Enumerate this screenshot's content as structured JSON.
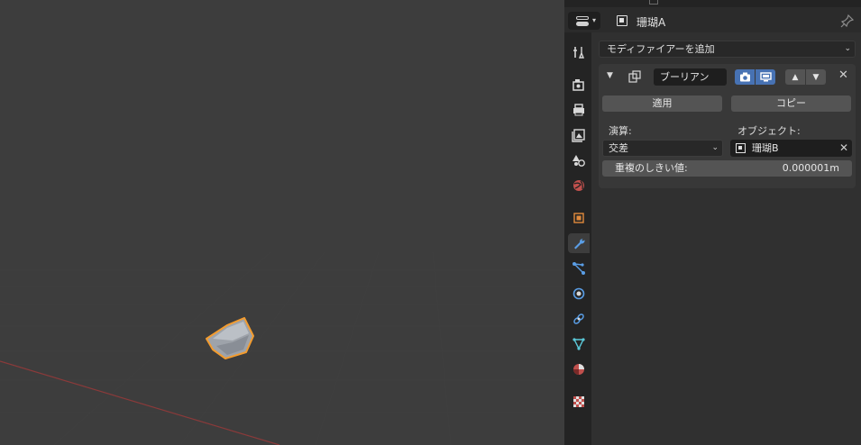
{
  "header": {
    "object_name": "珊瑚A"
  },
  "add_modifier": {
    "label": "モディファイアーを追加"
  },
  "modifier": {
    "name": "ブーリアン",
    "apply_label": "適用",
    "copy_label": "コピー",
    "operation_label": "演算:",
    "operation_value": "交差",
    "object_label": "オブジェクト:",
    "object_value": "珊瑚B",
    "threshold_label": "重複のしきい値:",
    "threshold_value": "0.000001m"
  },
  "tabs": [
    {
      "icon": "tool-icon",
      "active": false
    },
    {
      "icon": "render-icon",
      "active": false
    },
    {
      "icon": "output-icon",
      "active": false
    },
    {
      "icon": "view-layer-icon",
      "active": false
    },
    {
      "icon": "scene-icon",
      "active": false
    },
    {
      "icon": "world-icon",
      "active": false
    },
    {
      "icon": "object-icon",
      "active": false
    },
    {
      "icon": "wrench-icon",
      "active": true
    },
    {
      "icon": "particles-icon",
      "active": false
    },
    {
      "icon": "physics-icon",
      "active": false
    },
    {
      "icon": "constraints-icon",
      "active": false
    },
    {
      "icon": "object-data-icon",
      "active": false
    },
    {
      "icon": "material-icon",
      "active": false
    },
    {
      "icon": "texture-icon",
      "active": false
    }
  ],
  "colors": {
    "viewport_bg": "#3d3d3d",
    "selection_outline": "#f39c2f",
    "accent_blue": "#4772b3",
    "x_axis": "#8a3a3a"
  }
}
